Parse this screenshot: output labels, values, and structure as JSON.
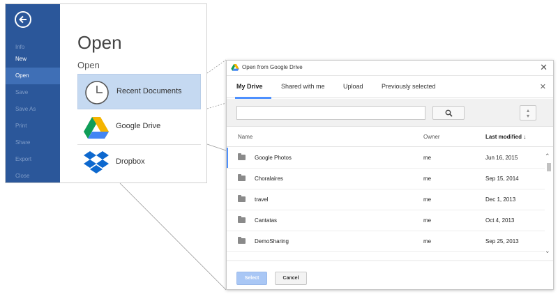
{
  "word": {
    "sidebar": {
      "items": [
        {
          "label": "Info"
        },
        {
          "label": "New"
        },
        {
          "label": "Open"
        },
        {
          "label": "Save"
        },
        {
          "label": "Save As"
        },
        {
          "label": "Print"
        },
        {
          "label": "Share"
        },
        {
          "label": "Export"
        },
        {
          "label": "Close"
        }
      ],
      "selected": "Open"
    },
    "title": "Open",
    "subtitle": "Open",
    "places": [
      {
        "label": "Recent Documents",
        "icon": "clock-icon",
        "selected": true
      },
      {
        "label": "Google Drive",
        "icon": "google-drive-icon",
        "selected": false
      },
      {
        "label": "Dropbox",
        "icon": "dropbox-icon",
        "selected": false
      }
    ],
    "colors": {
      "sidebar": "#2b579a",
      "selected_place": "#c5d9f1"
    }
  },
  "dialog": {
    "title": "Open from Google Drive",
    "tabs": [
      {
        "label": "My Drive",
        "active": true
      },
      {
        "label": "Shared with me",
        "active": false
      },
      {
        "label": "Upload",
        "active": false
      },
      {
        "label": "Previously selected",
        "active": false
      }
    ],
    "search": {
      "value": "",
      "placeholder": ""
    },
    "columns": {
      "name": "Name",
      "owner": "Owner",
      "modified": "Last modified ↓"
    },
    "rows": [
      {
        "name": "Google Photos",
        "owner": "me",
        "modified": "Jun 16, 2015"
      },
      {
        "name": "Choralaires",
        "owner": "me",
        "modified": "Sep 15, 2014"
      },
      {
        "name": "travel",
        "owner": "me",
        "modified": "Dec 1, 2013"
      },
      {
        "name": "Cantatas",
        "owner": "me",
        "modified": "Oct 4, 2013"
      },
      {
        "name": "DemoSharing",
        "owner": "me",
        "modified": "Sep 25, 2013"
      }
    ],
    "buttons": {
      "select": "Select",
      "cancel": "Cancel"
    },
    "colors": {
      "accent": "#4d90fe",
      "select_button": "#a9c7f5"
    }
  }
}
